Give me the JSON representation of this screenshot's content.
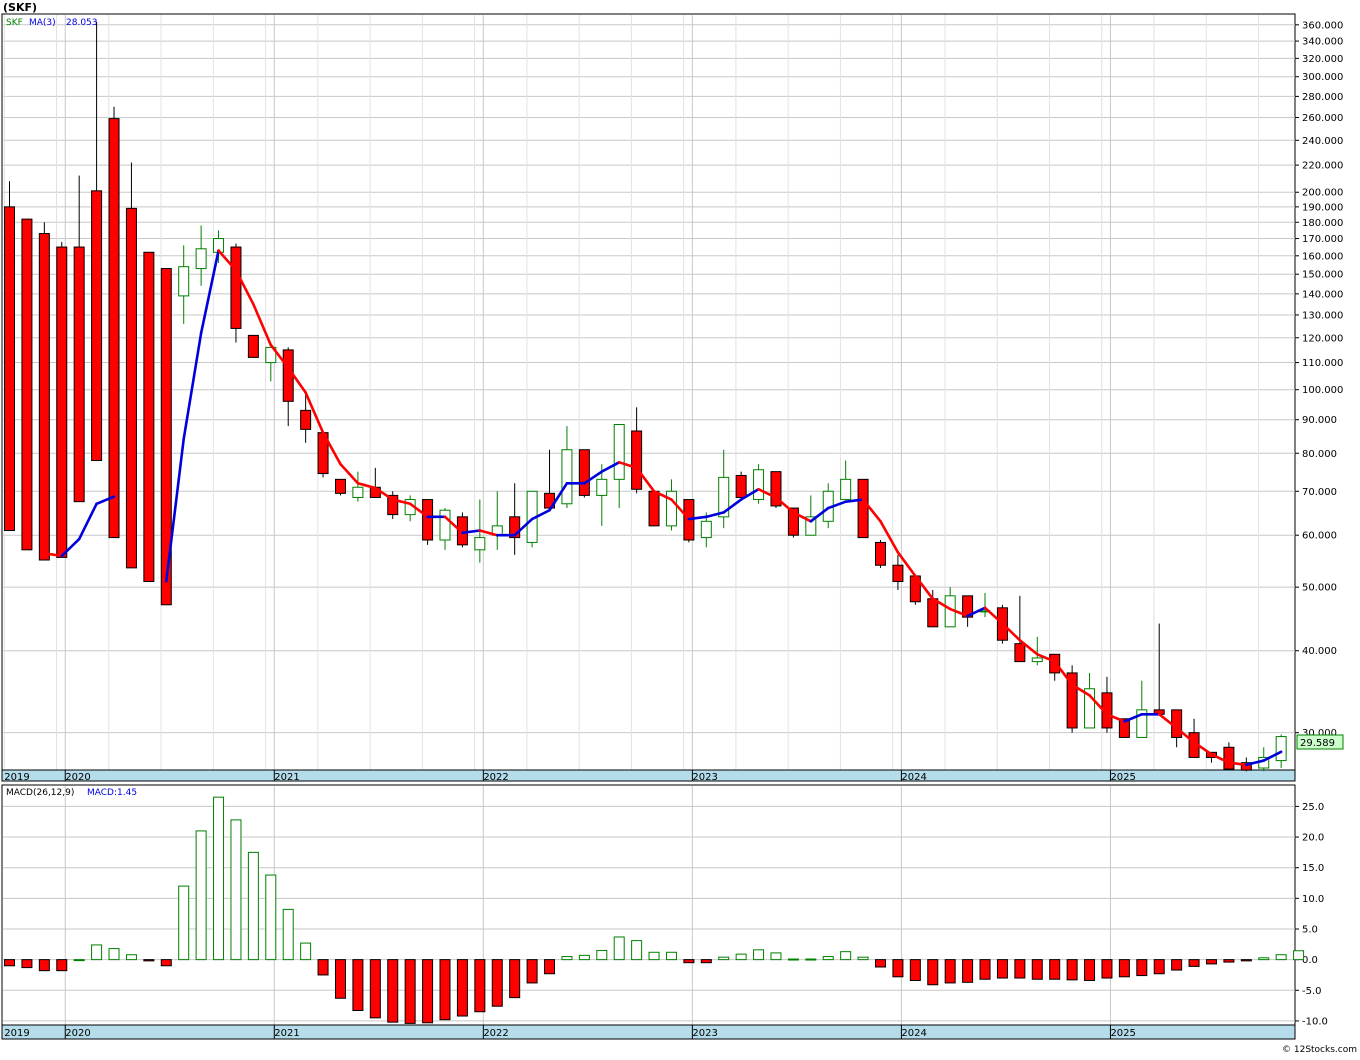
{
  "header": {
    "title": "(SKF)",
    "legend_symbol": "SKF",
    "legend_ma_label": "MA(3)",
    "legend_ma_value": "28.053",
    "macd_label": "MACD(26,12,9)",
    "macd_value_label": "MACD:1.45",
    "last_price_label": "29.589",
    "copyright": "© 12Stocks.com"
  },
  "colors": {
    "up": "#008000",
    "down": "#ff0000",
    "ma_up": "#0000dd",
    "ma_down": "#ff0000",
    "axis_band": "#b4dcea",
    "grid": "#c8c8c8",
    "price_box": "#ccffcc"
  },
  "chart_data": [
    {
      "type": "candlestick",
      "scale": "log",
      "ylim": [
        26.5,
        370
      ],
      "y_ticks": [
        30,
        40,
        50,
        60,
        70,
        80,
        90,
        100,
        110,
        120,
        130,
        140,
        150,
        160,
        170,
        180,
        190,
        200,
        220,
        240,
        260,
        280,
        300,
        320,
        340,
        360
      ],
      "y_tick_labels": [
        "30.000",
        "40.000",
        "50.000",
        "60.000",
        "70.000",
        "80.000",
        "90.000",
        "100.000",
        "110.000",
        "120.000",
        "130.000",
        "140.000",
        "150.000",
        "160.000",
        "170.000",
        "180.000",
        "190.000",
        "200.000",
        "220.000",
        "240.000",
        "260.000",
        "280.000",
        "300.000",
        "320.000",
        "340.000",
        "360.000"
      ],
      "x_labels": [
        {
          "label": "2019",
          "index": -0.3
        },
        {
          "label": "2020",
          "index": 3.2
        },
        {
          "label": "2021",
          "index": 15.2
        },
        {
          "label": "2022",
          "index": 27.2
        },
        {
          "label": "2023",
          "index": 39.2
        },
        {
          "label": "2024",
          "index": 51.2
        },
        {
          "label": "2025",
          "index": 63.2
        }
      ],
      "bars": [
        {
          "o": 190,
          "h": 208,
          "l": 61,
          "c": 61
        },
        {
          "o": 182,
          "h": 182,
          "l": 57,
          "c": 57
        },
        {
          "o": 173,
          "h": 180,
          "l": 55,
          "c": 55
        },
        {
          "o": 165,
          "h": 168,
          "l": 55.5,
          "c": 55.5
        },
        {
          "o": 165,
          "h": 212,
          "l": 67.5,
          "c": 67.5
        },
        {
          "o": 201,
          "h": 364,
          "l": 78,
          "c": 78
        },
        {
          "o": 259,
          "h": 270,
          "l": 59.5,
          "c": 59.5
        },
        {
          "o": 189,
          "h": 222,
          "l": 53.5,
          "c": 53.5
        },
        {
          "o": 162,
          "h": 162,
          "l": 51,
          "c": 51
        },
        {
          "o": 153,
          "h": 153,
          "l": 47,
          "c": 47
        },
        {
          "o": 139,
          "h": 166,
          "l": 126,
          "c": 154
        },
        {
          "o": 153,
          "h": 178,
          "l": 144,
          "c": 164
        },
        {
          "o": 162,
          "h": 175,
          "l": 156,
          "c": 170
        },
        {
          "o": 165,
          "h": 167,
          "l": 118,
          "c": 124
        },
        {
          "o": 121,
          "h": 121,
          "l": 112,
          "c": 112
        },
        {
          "o": 110,
          "h": 118,
          "l": 103,
          "c": 116
        },
        {
          "o": 115,
          "h": 116,
          "l": 88,
          "c": 96
        },
        {
          "o": 93,
          "h": 99,
          "l": 83,
          "c": 87
        },
        {
          "o": 86,
          "h": 86,
          "l": 73.5,
          "c": 74.5
        },
        {
          "o": 73,
          "h": 73,
          "l": 69,
          "c": 69.5
        },
        {
          "o": 68.5,
          "h": 75,
          "l": 67.5,
          "c": 71
        },
        {
          "o": 71,
          "h": 76,
          "l": 68.5,
          "c": 68.5
        },
        {
          "o": 69,
          "h": 70,
          "l": 63.5,
          "c": 64.5
        },
        {
          "o": 64.5,
          "h": 69,
          "l": 63,
          "c": 68
        },
        {
          "o": 68,
          "h": 68,
          "l": 58,
          "c": 59
        },
        {
          "o": 59,
          "h": 66,
          "l": 57,
          "c": 65.5
        },
        {
          "o": 64,
          "h": 65,
          "l": 57.5,
          "c": 58
        },
        {
          "o": 57,
          "h": 68,
          "l": 54.5,
          "c": 59.5
        },
        {
          "o": 60,
          "h": 70,
          "l": 57,
          "c": 62
        },
        {
          "o": 64,
          "h": 72,
          "l": 56,
          "c": 59.5
        },
        {
          "o": 58.5,
          "h": 70,
          "l": 57.5,
          "c": 70
        },
        {
          "o": 69.5,
          "h": 81,
          "l": 66,
          "c": 66
        },
        {
          "o": 67,
          "h": 88,
          "l": 66,
          "c": 81
        },
        {
          "o": 81,
          "h": 81,
          "l": 68.5,
          "c": 69
        },
        {
          "o": 69,
          "h": 77,
          "l": 62,
          "c": 73
        },
        {
          "o": 73,
          "h": 88,
          "l": 66,
          "c": 88.5
        },
        {
          "o": 86.5,
          "h": 94,
          "l": 69.5,
          "c": 70.5
        },
        {
          "o": 70,
          "h": 70,
          "l": 62,
          "c": 62
        },
        {
          "o": 62,
          "h": 73,
          "l": 61,
          "c": 70
        },
        {
          "o": 68,
          "h": 68,
          "l": 58.5,
          "c": 59
        },
        {
          "o": 59.5,
          "h": 65,
          "l": 57.5,
          "c": 63
        },
        {
          "o": 64,
          "h": 81,
          "l": 61.5,
          "c": 73.5
        },
        {
          "o": 74,
          "h": 75,
          "l": 68,
          "c": 68.5
        },
        {
          "o": 68,
          "h": 77,
          "l": 67,
          "c": 75.5
        },
        {
          "o": 75,
          "h": 75,
          "l": 66,
          "c": 66.5
        },
        {
          "o": 66,
          "h": 66,
          "l": 59.5,
          "c": 60
        },
        {
          "o": 60,
          "h": 69,
          "l": 60,
          "c": 64
        },
        {
          "o": 63,
          "h": 72,
          "l": 61.5,
          "c": 70
        },
        {
          "o": 68,
          "h": 78,
          "l": 68,
          "c": 73
        },
        {
          "o": 73,
          "h": 73,
          "l": 59.5,
          "c": 59.5
        },
        {
          "o": 58.5,
          "h": 59,
          "l": 53.5,
          "c": 54
        },
        {
          "o": 54,
          "h": 56,
          "l": 49.5,
          "c": 51
        },
        {
          "o": 52,
          "h": 52,
          "l": 47,
          "c": 47.5
        },
        {
          "o": 48,
          "h": 49.5,
          "l": 43.5,
          "c": 43.5
        },
        {
          "o": 43.5,
          "h": 50,
          "l": 43.5,
          "c": 48.5
        },
        {
          "o": 48.5,
          "h": 48.5,
          "l": 43.5,
          "c": 45
        },
        {
          "o": 46,
          "h": 49,
          "l": 45,
          "c": 46
        },
        {
          "o": 46.5,
          "h": 47,
          "l": 41,
          "c": 41.5
        },
        {
          "o": 41,
          "h": 48.5,
          "l": 38.5,
          "c": 38.5
        },
        {
          "o": 38.5,
          "h": 42,
          "l": 38,
          "c": 39
        },
        {
          "o": 39.5,
          "h": 39.5,
          "l": 36,
          "c": 37
        },
        {
          "o": 37,
          "h": 38,
          "l": 30,
          "c": 30.5
        },
        {
          "o": 30.5,
          "h": 37,
          "l": 30.5,
          "c": 35
        },
        {
          "o": 34.5,
          "h": 36.5,
          "l": 30,
          "c": 30.5
        },
        {
          "o": 31.5,
          "h": 31.5,
          "l": 29.5,
          "c": 29.5
        },
        {
          "o": 29.5,
          "h": 36,
          "l": 29.5,
          "c": 32.5
        },
        {
          "o": 32.5,
          "h": 44,
          "l": 32,
          "c": 32
        },
        {
          "o": 32.5,
          "h": 32.5,
          "l": 28.5,
          "c": 29.5
        },
        {
          "o": 30,
          "h": 31.5,
          "l": 27.5,
          "c": 27.5
        },
        {
          "o": 28,
          "h": 28,
          "l": 27,
          "c": 27.5
        },
        {
          "o": 28.5,
          "h": 29,
          "l": 26.3,
          "c": 26.4
        },
        {
          "o": 27,
          "h": 27.5,
          "l": 26.2,
          "c": 26.3
        },
        {
          "o": 26.5,
          "h": 28.5,
          "l": 26.2,
          "c": 27.5
        },
        {
          "o": 27.2,
          "h": 29.8,
          "l": 26.5,
          "c": 29.59
        }
      ],
      "ma3": [
        null,
        null,
        56.3,
        55.8,
        59.2,
        67,
        68.7,
        null,
        null,
        51,
        84.1,
        122,
        163,
        152,
        135,
        117,
        108,
        99,
        86,
        77,
        72,
        70.8,
        68,
        67,
        64,
        64,
        60.5,
        61,
        60,
        60,
        63.5,
        65.5,
        72,
        72,
        75,
        77.5,
        76,
        70,
        68,
        63.5,
        64,
        65,
        68,
        70.5,
        68.5,
        65,
        63,
        66,
        67.5,
        68,
        63,
        56.5,
        52,
        48,
        46.3,
        45.2,
        46.5,
        44,
        41.5,
        39.5,
        38.5,
        35.5,
        34.2,
        32,
        31.2,
        32,
        32,
        30.5,
        29,
        27.8,
        27,
        26.8,
        27.2,
        28.05
      ]
    },
    {
      "type": "bar",
      "name": "MACD histogram",
      "ylim": [
        -10.5,
        28
      ],
      "y_ticks": [
        -10,
        -5,
        0,
        5,
        10,
        15,
        20,
        25
      ],
      "y_tick_labels": [
        "-10.0",
        "-5.0",
        "0.0",
        "5.0",
        "10.0",
        "15.0",
        "20.0",
        "25.0"
      ],
      "x_labels": [
        {
          "label": "2019",
          "index": -0.3
        },
        {
          "label": "2020",
          "index": 3.2
        },
        {
          "label": "2021",
          "index": 15.2
        },
        {
          "label": "2022",
          "index": 27.2
        },
        {
          "label": "2023",
          "index": 39.2
        },
        {
          "label": "2024",
          "index": 51.2
        },
        {
          "label": "2025",
          "index": 63.2
        }
      ],
      "values": [
        -1,
        -1.3,
        -1.8,
        -1.8,
        0,
        2.4,
        1.8,
        0.8,
        -0.2,
        -1,
        12,
        21,
        26.5,
        22.8,
        17.5,
        13.8,
        8.2,
        2.7,
        -2.5,
        -6.3,
        -8.3,
        -9.5,
        -10.2,
        -10.4,
        -10.3,
        -9.8,
        -9.2,
        -8.5,
        -7.6,
        -6.2,
        -3.8,
        -2.3,
        0.5,
        0.7,
        1.5,
        3.7,
        3.1,
        1.2,
        1.2,
        -0.5,
        -0.5,
        0.4,
        0.9,
        1.6,
        1.1,
        0.1,
        0.1,
        0.5,
        1.3,
        0.4,
        -1.2,
        -2.8,
        -3.4,
        -4.1,
        -3.8,
        -3.7,
        -3.2,
        -3,
        -3,
        -3.2,
        -3.2,
        -3.3,
        -3.4,
        -3,
        -2.8,
        -2.6,
        -2.3,
        -1.7,
        -1.1,
        -0.7,
        -0.4,
        -0.2,
        0.3,
        0.8,
        1.45
      ]
    }
  ]
}
